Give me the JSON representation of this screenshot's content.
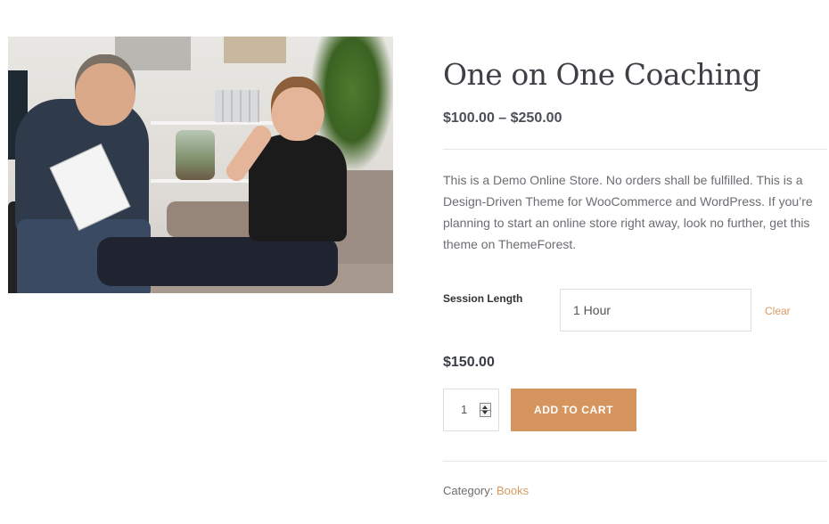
{
  "product": {
    "title": "One on One Coaching",
    "price_range": "$100.00 – $250.00",
    "description": "This is a Demo Online Store. No orders shall be fulfilled. This is a Design-Driven Theme for WooCommerce and WordPress. If you’re planning to start an online store right away, look no further, get this theme on ThemeForest.",
    "selected_price": "$150.00"
  },
  "variation": {
    "label": "Session Length",
    "selected_value": "1 Hour",
    "clear_label": "Clear"
  },
  "cart": {
    "quantity": "1",
    "add_to_cart_label": "ADD TO CART"
  },
  "meta": {
    "category_label": "Category:",
    "category_value": "Books"
  },
  "colors": {
    "accent": "#d6955e",
    "title": "#3f4046",
    "text": "#6d6d73"
  }
}
